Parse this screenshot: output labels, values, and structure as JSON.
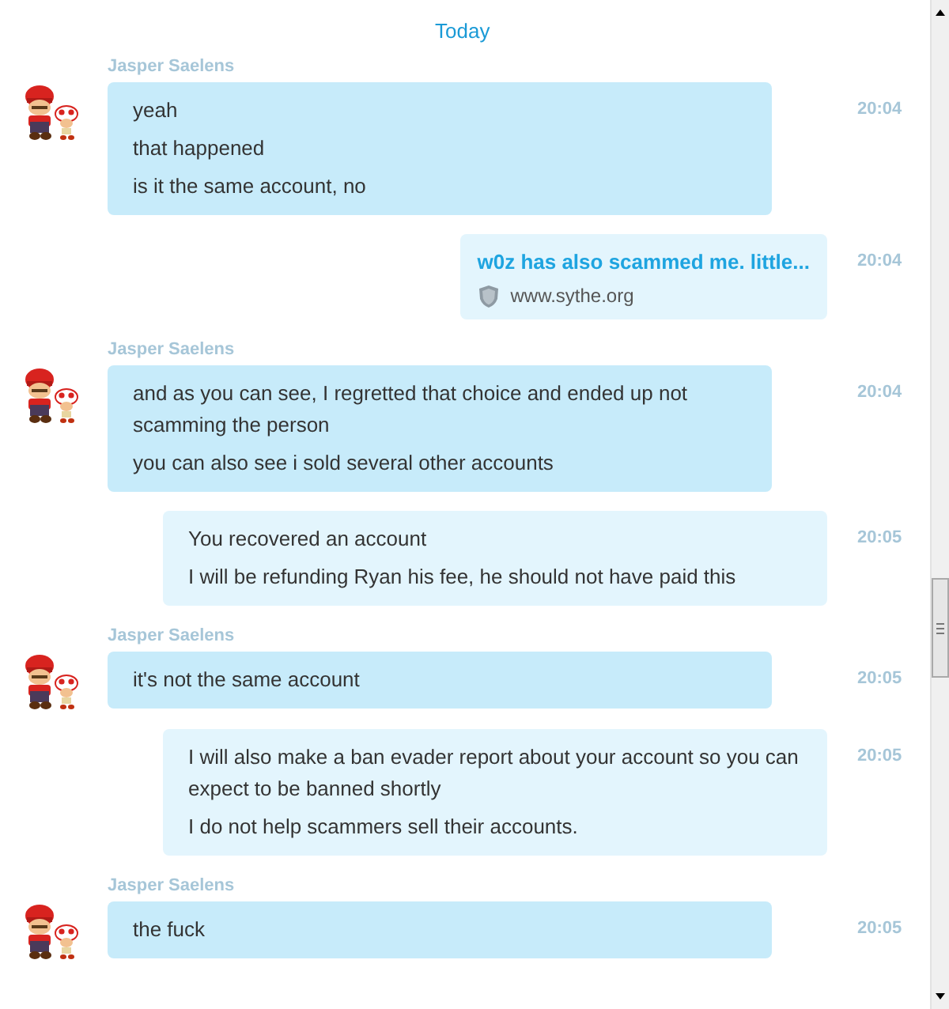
{
  "date_separator": "Today",
  "messages": [
    {
      "kind": "incoming",
      "sender": "Jasper Saelens",
      "lines": [
        "yeah",
        "that happened",
        "is it the same account, no"
      ],
      "time": "20:04"
    },
    {
      "kind": "link",
      "title": "w0z has also scammed me. little...",
      "domain": "www.sythe.org",
      "time": "20:04"
    },
    {
      "kind": "incoming",
      "sender": "Jasper Saelens",
      "lines": [
        "and as you can see, I regretted that choice and ended up not scamming the person",
        "you can also see i sold several other accounts"
      ],
      "time": "20:04"
    },
    {
      "kind": "outgoing",
      "lines": [
        "You recovered an account",
        "I will be refunding Ryan his fee, he should not have paid this"
      ],
      "time": "20:05"
    },
    {
      "kind": "incoming",
      "sender": "Jasper Saelens",
      "lines": [
        "it's not the same account"
      ],
      "time": "20:05"
    },
    {
      "kind": "outgoing",
      "lines": [
        "I will also make a ban evader report about your account so you can expect to be banned shortly",
        "I do not help scammers sell their accounts."
      ],
      "time": "20:05"
    },
    {
      "kind": "incoming",
      "sender": "Jasper Saelens",
      "lines": [
        "the fuck"
      ],
      "time": "20:05"
    }
  ]
}
